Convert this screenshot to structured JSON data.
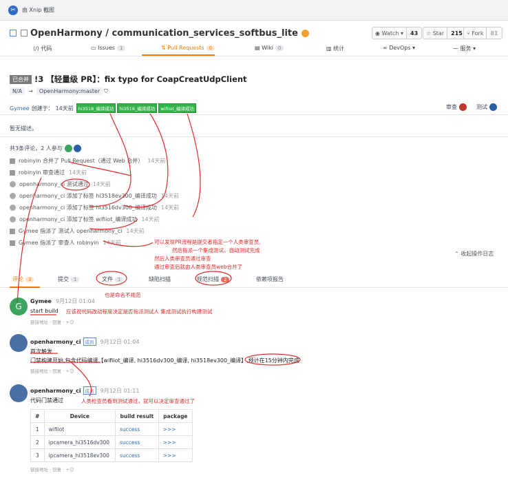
{
  "titlebar": {
    "app": "由 Xnip 截图"
  },
  "repo": {
    "name": "OpenHarmony / communication_services_softbus_lite",
    "watch": "Watch",
    "watch_count": "43",
    "star": "Star",
    "star_count": "215",
    "fork": "Fork",
    "fork_count": "81"
  },
  "tabs": [
    {
      "label": "代码"
    },
    {
      "label": "Issues",
      "count": "1"
    },
    {
      "label": "Pull Requests",
      "count": "0"
    },
    {
      "label": "Wiki",
      "count": "0"
    },
    {
      "label": "统计"
    },
    {
      "label": "DevOps"
    },
    {
      "label": "服务"
    }
  ],
  "pr": {
    "status": "已合并",
    "title": "!3 【轻量级 PR】：fix typo for CoapCreatUdpClient",
    "branch_from": "N/A",
    "branch_to": "OpenHarmony:master",
    "author": "Gymee",
    "created": "创建于：",
    "time": "14天前",
    "labels": [
      "hi3518_编译成功",
      "hi3516_编译成功",
      "wifiiot_编译成功"
    ],
    "review": "审查",
    "test": "测试",
    "description": "暂无描述。"
  },
  "activity": {
    "summary": "共3条评论，2 人参与",
    "items": [
      {
        "text": "robinyin 合并了 Pull Request（通过 Web 合并）",
        "time": "14天前"
      },
      {
        "text": "robinyin 审查通过",
        "time": "14天前"
      },
      {
        "text": "openharmony_ci 测试通过",
        "time": "14天前"
      },
      {
        "text": "openharmony_ci 添加了标签 hi3518ev300_编译成功",
        "time": "14天前"
      },
      {
        "text": "openharmony_ci 添加了标签 hi3516dv300_编译成功",
        "time": "14天前"
      },
      {
        "text": "openharmony_ci 添加了标签 wifiiot_编译成功",
        "time": "14天前"
      },
      {
        "text": "Gymee 指派了 测试人 openharmony_ci",
        "time": "14天前"
      },
      {
        "text": "Gymee 指派了 审查人 robinyin",
        "time": "14天前"
      }
    ],
    "collapse": "收起操作日志"
  },
  "notes": {
    "n1": "可以发现PR流程是提交者指定一个人类审查员,",
    "n2": "然后指派一个集成测试，自动测试完成",
    "n3": "然后人类审查员通过审查",
    "n4": "通过审查后就由人类审查员web合并了",
    "n5": "也是命名不规范",
    "n6": "应该视代码改动程度决定是否指派测试人 集成测试执行构建测试",
    "n7": "人类检查员看到测试通过，就可以决定审查通过了"
  },
  "subtabs": [
    {
      "label": "评论",
      "count": "3"
    },
    {
      "label": "提交",
      "count": "1"
    },
    {
      "label": "文件",
      "count": "1"
    },
    {
      "label": "缺陷扫描"
    },
    {
      "label": "规范扫描",
      "count": "2"
    },
    {
      "label": "依赖项报告"
    }
  ],
  "comments": [
    {
      "author": "Gymee",
      "time": "9月12日 01:04",
      "body": "start build",
      "actions": "链接地址 · 回复 · +☺"
    },
    {
      "author": "openharmony_ci",
      "role": "成员",
      "time": "9月12日 01:04",
      "l1": "首次触发",
      "l2": "门禁构建开始,包含代码编译【wifiiot_编译, hi3516dv300_编译, hi3518ev300_编译】,预计在15分钟内完成",
      "actions": "链接地址 · 回复 · +☺"
    },
    {
      "author": "openharmony_ci",
      "role": "成员",
      "time": "9月12日 01:11",
      "l1": "代码门禁通过",
      "actions": "链接地址 · 回复 · +☺"
    }
  ],
  "table": {
    "headers": [
      "#",
      "Device",
      "build result",
      "package"
    ],
    "rows": [
      [
        "1",
        "wifiiot",
        "success",
        ">>>"
      ],
      [
        "2",
        "ipcamera_hi3516dv300",
        "success",
        ">>>"
      ],
      [
        "3",
        "ipcamera_hi3518ev300",
        "success",
        ">>>"
      ]
    ]
  }
}
